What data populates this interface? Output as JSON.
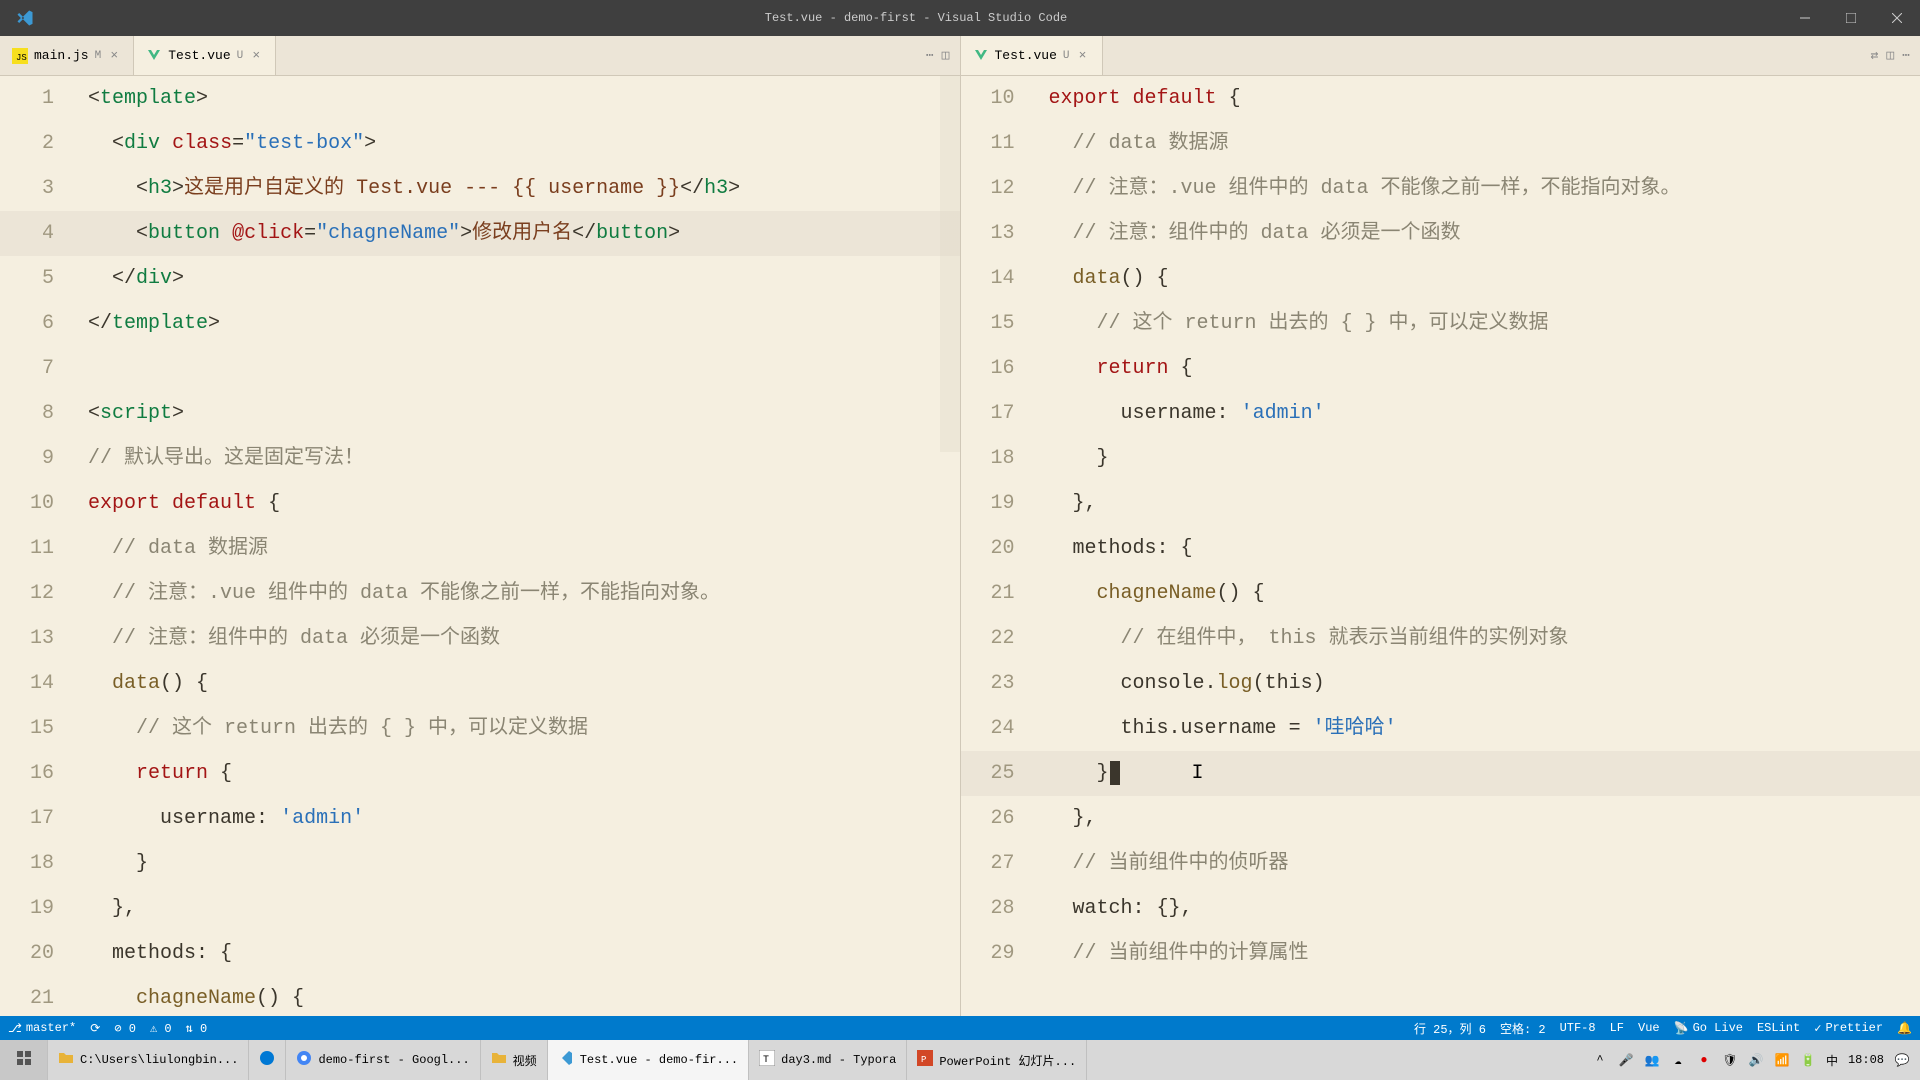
{
  "titlebar": {
    "title": "Test.vue - demo-first - Visual Studio Code"
  },
  "tabs": {
    "left": [
      {
        "name": "main.js",
        "mod": "M",
        "active": false,
        "icon": "js"
      },
      {
        "name": "Test.vue",
        "mod": "U",
        "active": true,
        "icon": "vue"
      }
    ],
    "right": [
      {
        "name": "Test.vue",
        "mod": "U",
        "active": true,
        "icon": "vue"
      }
    ]
  },
  "left_code": [
    {
      "n": "1",
      "html": "<span class='t-punct'>&lt;</span><span class='t-tag'>template</span><span class='t-punct'>&gt;</span>"
    },
    {
      "n": "2",
      "html": "  <span class='t-punct'>&lt;</span><span class='t-tag'>div</span> <span class='t-attr'>class</span><span class='t-punct'>=</span><span class='t-str'>\"test-box\"</span><span class='t-punct'>&gt;</span>"
    },
    {
      "n": "3",
      "html": "    <span class='t-punct'>&lt;</span><span class='t-tag'>h3</span><span class='t-punct'>&gt;</span><span class='t-txt'>这是用户自定义的 Test.vue --- {{ username }}</span><span class='t-punct'>&lt;/</span><span class='t-tag'>h3</span><span class='t-punct'>&gt;</span>"
    },
    {
      "n": "4",
      "hl": true,
      "html": "    <span class='t-punct'>&lt;</span><span class='t-tag'>button</span> <span class='t-attr'>@click</span><span class='t-punct'>=</span><span class='t-str'>\"chagneName\"</span><span class='t-punct'>&gt;</span><span class='t-txt'>修改用户名</span><span class='t-punct'>&lt;/</span><span class='t-tag'>button</span><span class='t-punct'>&gt;</span>"
    },
    {
      "n": "5",
      "html": "  <span class='t-punct'>&lt;/</span><span class='t-tag'>div</span><span class='t-punct'>&gt;</span>"
    },
    {
      "n": "6",
      "html": "<span class='t-punct'>&lt;/</span><span class='t-tag'>template</span><span class='t-punct'>&gt;</span>"
    },
    {
      "n": "7",
      "html": ""
    },
    {
      "n": "8",
      "html": "<span class='t-punct'>&lt;</span><span class='t-tag'>script</span><span class='t-punct'>&gt;</span>"
    },
    {
      "n": "9",
      "html": "<span class='t-comment'>// 默认导出。这是固定写法！</span>"
    },
    {
      "n": "10",
      "html": "<span class='t-kw'>export</span> <span class='t-kw'>default</span> <span class='t-punct'>{</span>"
    },
    {
      "n": "11",
      "html": "  <span class='t-comment'>// data 数据源</span>"
    },
    {
      "n": "12",
      "html": "  <span class='t-comment'>// 注意：.vue 组件中的 data 不能像之前一样，不能指向对象。</span>"
    },
    {
      "n": "13",
      "html": "  <span class='t-comment'>// 注意：组件中的 data 必须是一个函数</span>"
    },
    {
      "n": "14",
      "html": "  <span class='t-fn'>data</span><span class='t-punct'>() {</span>"
    },
    {
      "n": "15",
      "html": "    <span class='t-comment'>// 这个 return 出去的 { } 中，可以定义数据</span>"
    },
    {
      "n": "16",
      "html": "    <span class='t-kw'>return</span> <span class='t-punct'>{</span>"
    },
    {
      "n": "17",
      "html": "      <span class='t-id'>username:</span> <span class='t-str'>'admin'</span>"
    },
    {
      "n": "18",
      "html": "    <span class='t-punct'>}</span>"
    },
    {
      "n": "19",
      "html": "  <span class='t-punct'>},</span>"
    },
    {
      "n": "20",
      "html": "  <span class='t-id'>methods:</span> <span class='t-punct'>{</span>"
    },
    {
      "n": "21",
      "html": "    <span class='t-fn'>chagneName</span><span class='t-punct'>() {</span>"
    }
  ],
  "right_code": [
    {
      "n": "10",
      "html": "<span class='t-kw'>export</span> <span class='t-kw'>default</span> <span class='t-punct'>{</span>"
    },
    {
      "n": "11",
      "html": "  <span class='t-comment'>// data 数据源</span>"
    },
    {
      "n": "12",
      "html": "  <span class='t-comment'>// 注意：.vue 组件中的 data 不能像之前一样，不能指向对象。</span>"
    },
    {
      "n": "13",
      "html": "  <span class='t-comment'>// 注意：组件中的 data 必须是一个函数</span>"
    },
    {
      "n": "14",
      "html": "  <span class='t-fn'>data</span><span class='t-punct'>() {</span>"
    },
    {
      "n": "15",
      "html": "    <span class='t-comment'>// 这个 return 出去的 { } 中，可以定义数据</span>"
    },
    {
      "n": "16",
      "html": "    <span class='t-kw'>return</span> <span class='t-punct'>{</span>"
    },
    {
      "n": "17",
      "html": "      <span class='t-id'>username:</span> <span class='t-str'>'admin'</span>"
    },
    {
      "n": "18",
      "html": "    <span class='t-punct'>}</span>"
    },
    {
      "n": "19",
      "html": "  <span class='t-punct'>},</span>"
    },
    {
      "n": "20",
      "html": "  <span class='t-id'>methods:</span> <span class='t-punct'>{</span>"
    },
    {
      "n": "21",
      "html": "    <span class='t-fn'>chagneName</span><span class='t-punct'>() {</span>"
    },
    {
      "n": "22",
      "html": "      <span class='t-comment'>// 在组件中， this 就表示当前组件的实例对象</span>"
    },
    {
      "n": "23",
      "html": "      <span class='t-id'>console</span><span class='t-punct'>.</span><span class='t-fn'>log</span><span class='t-punct'>(</span><span class='t-id'>this</span><span class='t-punct'>)</span>"
    },
    {
      "n": "24",
      "html": "      <span class='t-id'>this</span><span class='t-punct'>.</span><span class='t-id'>username</span> <span class='t-punct'>=</span> <span class='t-str'>'哇哈哈'</span>"
    },
    {
      "n": "25",
      "hl": true,
      "html": "    <span class='t-punct'>}</span><span class='cursor-blk'></span>      I"
    },
    {
      "n": "26",
      "html": "  <span class='t-punct'>},</span>"
    },
    {
      "n": "27",
      "html": "  <span class='t-comment'>// 当前组件中的侦听器</span>"
    },
    {
      "n": "28",
      "html": "  <span class='t-id'>watch:</span> <span class='t-punct'>{},</span>"
    },
    {
      "n": "29",
      "html": "  <span class='t-comment'>// 当前组件中的计算属性</span>"
    }
  ],
  "status": {
    "branch": "master*",
    "sync": "⟳",
    "errors": "⊘ 0",
    "warnings": "⚠ 0",
    "portfwd": "⇅ 0",
    "pos": "行 25，列 6",
    "spaces": "空格: 2",
    "encoding": "UTF-8",
    "eol": "LF",
    "lang": "Vue",
    "golive": "Go Live",
    "eslint": "ESLint",
    "prettier": "Prettier"
  },
  "taskbar": {
    "items": [
      {
        "label": "",
        "icon": "windows",
        "start": true
      },
      {
        "label": "C:\\Users\\liulongbin...",
        "icon": "folder"
      },
      {
        "label": "",
        "icon": "edge"
      },
      {
        "label": "demo-first - Googl...",
        "icon": "chrome"
      },
      {
        "label": "视频",
        "icon": "folder"
      },
      {
        "label": "Test.vue - demo-fir...",
        "icon": "vscode",
        "active": true
      },
      {
        "label": "day3.md - Typora",
        "icon": "typora"
      },
      {
        "label": "PowerPoint 幻灯片...",
        "icon": "ppt"
      }
    ],
    "tray": {
      "ime": "中",
      "time": "18:08"
    }
  }
}
